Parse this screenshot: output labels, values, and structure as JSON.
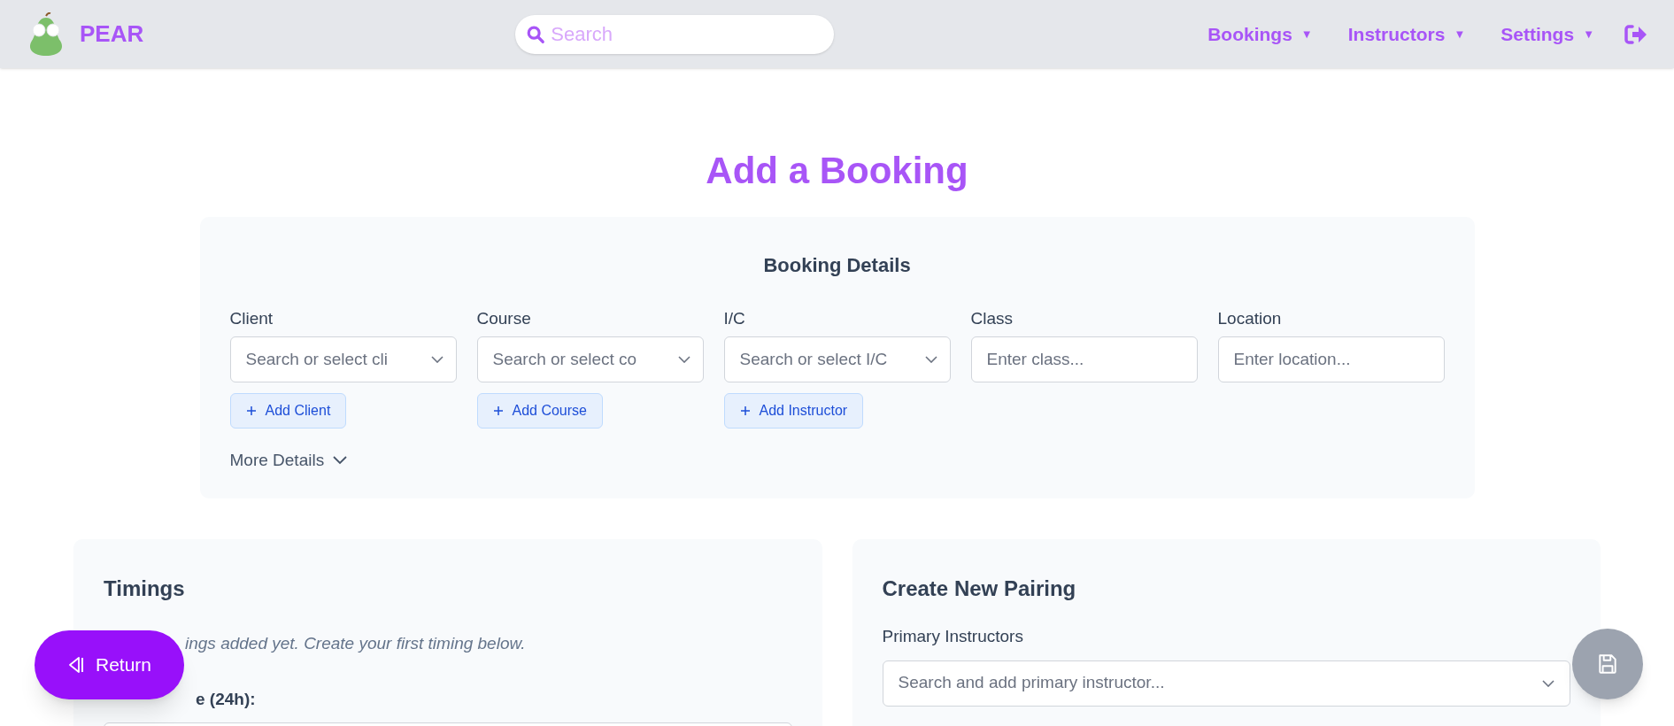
{
  "header": {
    "brand": "PEAR",
    "search": {
      "placeholder": "Search"
    },
    "nav": [
      {
        "label": "Bookings",
        "caret": "▼"
      },
      {
        "label": "Instructors",
        "caret": "▼"
      },
      {
        "label": "Settings",
        "caret": "▼"
      }
    ]
  },
  "title": "Add a Booking",
  "booking_details": {
    "heading": "Booking Details",
    "fields": [
      {
        "label": "Client",
        "kind": "select",
        "placeholder": "Search or select cli",
        "add_button": "Add Client"
      },
      {
        "label": "Course",
        "kind": "select",
        "placeholder": "Search or select co",
        "add_button": "Add Course"
      },
      {
        "label": "I/C",
        "kind": "select",
        "placeholder": "Search or select I/C",
        "add_button": "Add Instructor"
      },
      {
        "label": "Class",
        "kind": "text",
        "placeholder": "Enter class..."
      },
      {
        "label": "Location",
        "kind": "text",
        "placeholder": "Enter location..."
      }
    ],
    "more_details": {
      "label": "More Details",
      "expanded": false
    }
  },
  "timings": {
    "heading": "Timings",
    "empty_message": "ings added yet. Create your first timing below.",
    "start_label": "e (24h):"
  },
  "pairing": {
    "heading": "Create New Pairing",
    "primary_label": "Primary Instructors",
    "primary_placeholder": "Search and add primary instructor..."
  },
  "return_button": "Return"
}
